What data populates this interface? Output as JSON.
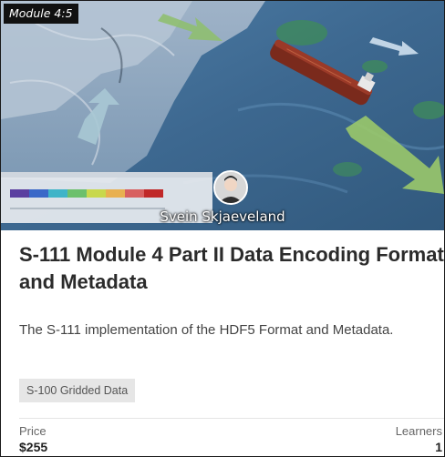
{
  "card": {
    "module_label": "Module 4:5",
    "instructor_name": "Svein Skjaeveland",
    "title": "S-111 Module 4 Part II Data Encoding Format and Metadata",
    "description": "The S-111 implementation of the HDF5 Format and Metadata.",
    "tag": "S-100 Gridded Data",
    "price_label": "Price",
    "price_value": "$255",
    "learners_label": "Learners",
    "learners_value": "1"
  },
  "hero_image": {
    "icon": "ocean-current-map-with-ship",
    "legend_colors": [
      "#5b3fa0",
      "#3a68c8",
      "#3fb4c8",
      "#6cc06c",
      "#c8d84c",
      "#e8b050",
      "#d86060",
      "#c02828"
    ]
  },
  "colors": {
    "title": "#2b2b2b",
    "tag_background": "#e6e6e6",
    "module_badge": "#111111"
  }
}
